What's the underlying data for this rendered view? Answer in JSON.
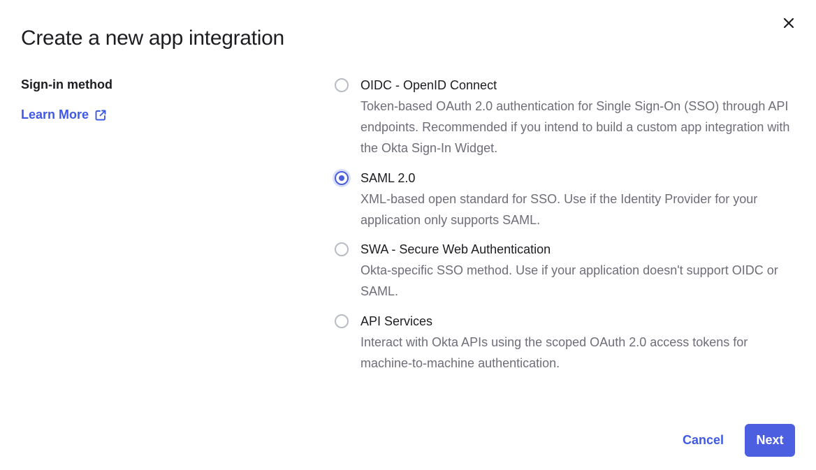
{
  "dialog": {
    "title": "Create a new app integration",
    "close_icon": "close-icon"
  },
  "sign_in": {
    "label": "Sign-in method",
    "learn_more": "Learn More",
    "learn_more_icon": "external-link-icon"
  },
  "options": [
    {
      "title": "OIDC - OpenID Connect",
      "description": "Token-based OAuth 2.0 authentication for Single Sign-On (SSO) through API endpoints. Recommended if you intend to build a custom app integration with the Okta Sign-In Widget.",
      "selected": false
    },
    {
      "title": "SAML 2.0",
      "description": "XML-based open standard for SSO. Use if the Identity Provider for your application only supports SAML.",
      "selected": true
    },
    {
      "title": "SWA - Secure Web Authentication",
      "description": "Okta-specific SSO method. Use if your application doesn't support OIDC or SAML.",
      "selected": false
    },
    {
      "title": "API Services",
      "description": "Interact with Okta APIs using the scoped OAuth 2.0 access tokens for machine-to-machine authentication.",
      "selected": false
    }
  ],
  "footer": {
    "cancel_label": "Cancel",
    "next_label": "Next"
  },
  "colors": {
    "accent": "#4b5fe0",
    "link": "#3f59e4",
    "text": "#1d1d21",
    "muted": "#6e6e78"
  }
}
